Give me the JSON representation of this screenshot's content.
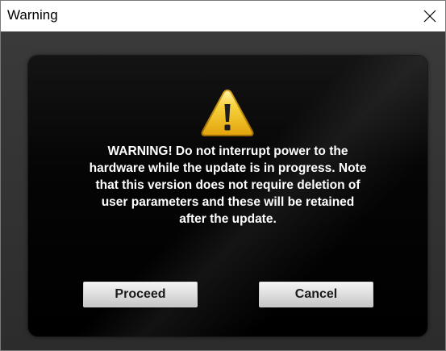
{
  "window": {
    "title": "Warning"
  },
  "dialog": {
    "icon": "warning-triangle-icon",
    "message": "WARNING! Do not interrupt power to the\nhardware while the update is in progress. Note\nthat this version does not require deletion of\nuser parameters and these will be retained\nafter the update.",
    "proceed_label": "Proceed",
    "cancel_label": "Cancel"
  },
  "colors": {
    "panel_background": "#000000",
    "frame_background": "#333333",
    "message_text": "#ffffff",
    "warning_yellow": "#f5c518"
  }
}
